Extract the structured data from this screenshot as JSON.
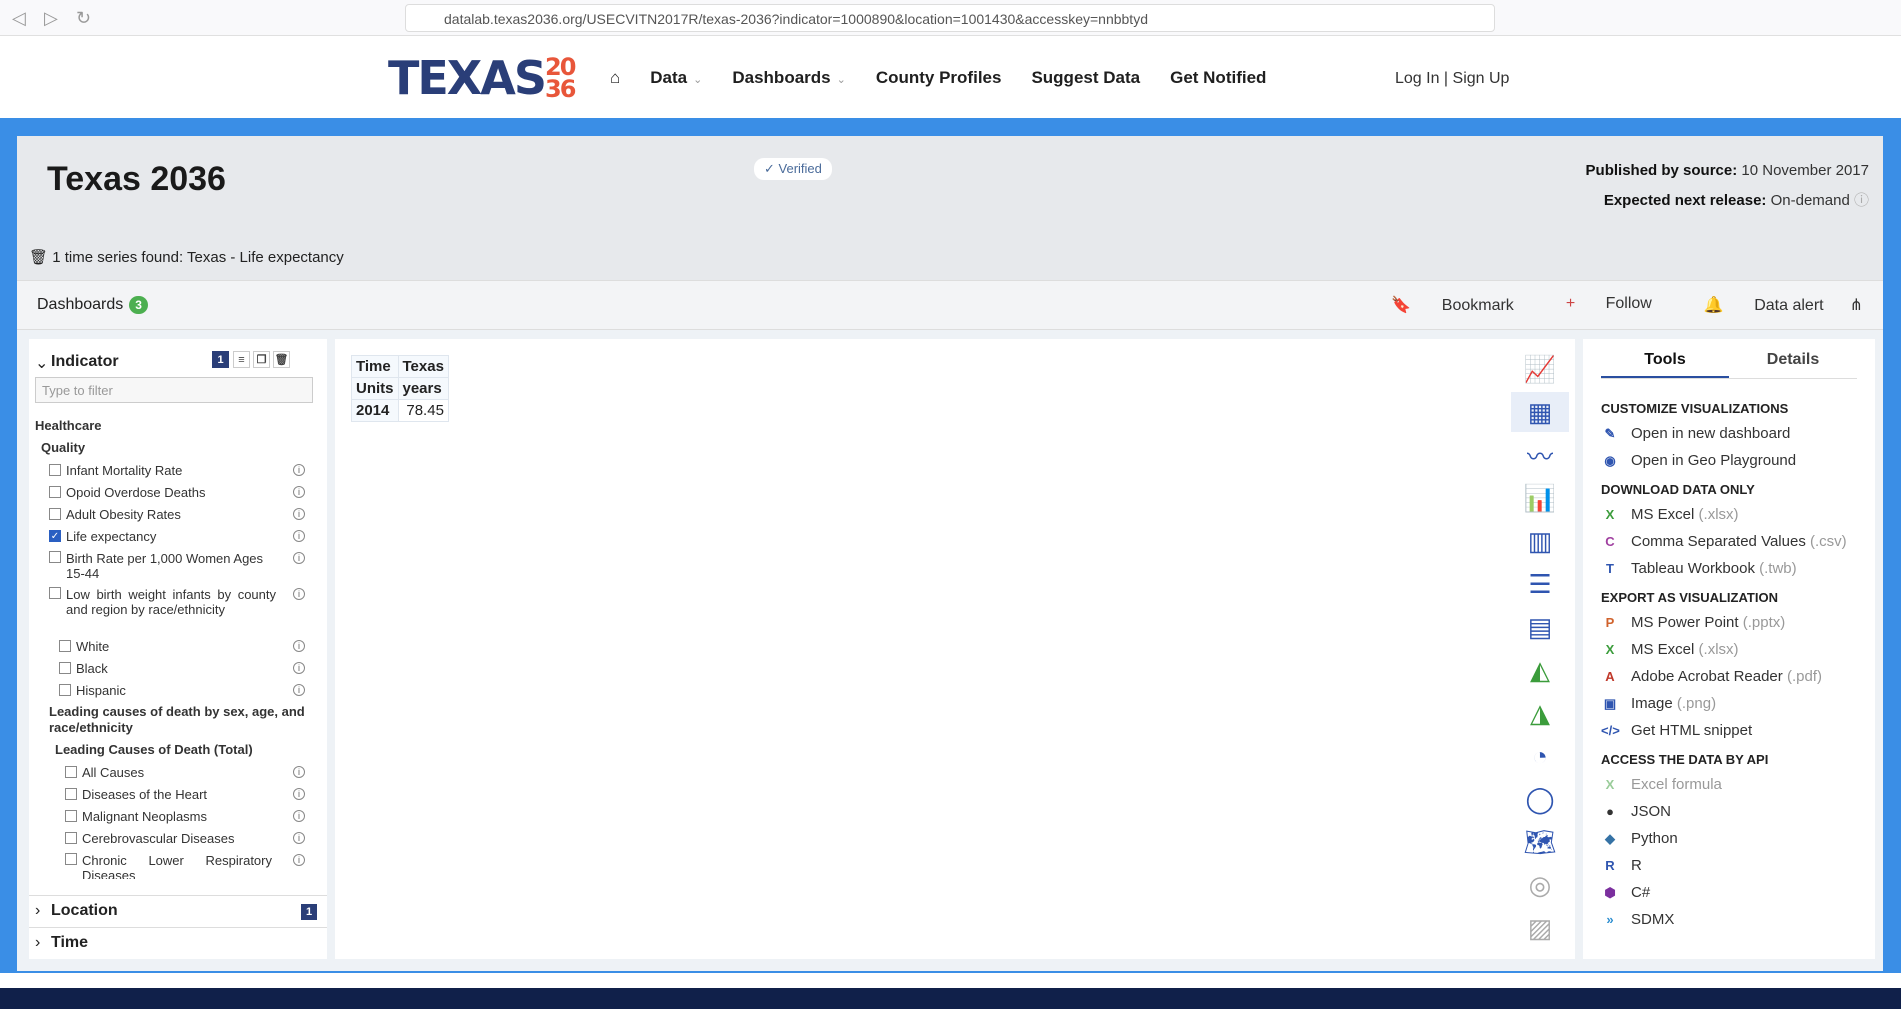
{
  "browser": {
    "url": "datalab.texas2036.org/USECVITN2017R/texas-2036?indicator=1000890&location=1001430&accesskey=nnbbtyd"
  },
  "site": {
    "logo_main": "TEXAS",
    "logo_num": "2036",
    "nav": [
      "Data",
      "Dashboards",
      "County Profiles",
      "Suggest Data",
      "Get Notified"
    ],
    "auth": "Log In | Sign Up"
  },
  "header": {
    "title": "Texas 2036",
    "verified": "✓ Verified",
    "published_label": "Published by source:",
    "published_value": "10 November 2017",
    "next_label": "Expected next release:",
    "next_value": "On-demand",
    "found": "1 time series found: Texas - Life expectancy"
  },
  "toolbar": {
    "dashboards": "Dashboards",
    "dashboards_count": "3",
    "bookmark": "Bookmark",
    "follow": "Follow",
    "alert": "Data alert"
  },
  "indicator": {
    "title": "Indicator",
    "count": "1",
    "filter_placeholder": "Type to filter",
    "healthcare": "Healthcare",
    "quality": "Quality",
    "items": [
      "Infant Mortality Rate",
      "Opoid Overdose Deaths",
      "Adult Obesity Rates",
      "Life expectancy",
      "Birth Rate per 1,000 Women Ages 15-44",
      "Low birth weight infants by county and region by race/ethnicity"
    ],
    "sub": [
      "White",
      "Black",
      "Hispanic"
    ],
    "group2": "Leading causes of death by sex, age, and race/ethnicity",
    "group3": "Leading Causes of Death (Total)",
    "causes": [
      "All Causes",
      "Diseases of the Heart",
      "Malignant Neoplasms",
      "Cerebrovascular Diseases",
      "Chronic Lower Respiratory Diseases"
    ],
    "location": "Location",
    "location_count": "1",
    "time": "Time"
  },
  "table": {
    "h1": "Time",
    "h2": "Texas",
    "u1": "Units",
    "u2": "years",
    "r1": "2014",
    "r2": "78.45"
  },
  "tabs": {
    "tools": "Tools",
    "details": "Details"
  },
  "tools": {
    "customize": "CUSTOMIZE VISUALIZATIONS",
    "new_dash": "Open in new dashboard",
    "geo": "Open in Geo Playground",
    "download": "DOWNLOAD DATA ONLY",
    "xlsx": "MS Excel",
    "xlsx_ext": "(.xlsx)",
    "csv": "Comma Separated Values",
    "csv_ext": "(.csv)",
    "twb": "Tableau Workbook",
    "twb_ext": "(.twb)",
    "export": "EXPORT AS VISUALIZATION",
    "pptx": "MS Power Point",
    "pptx_ext": "(.pptx)",
    "xlsx2": "MS Excel",
    "xlsx2_ext": "(.xlsx)",
    "pdf": "Adobe Acrobat Reader",
    "pdf_ext": "(.pdf)",
    "png": "Image",
    "png_ext": "(.png)",
    "html": "Get HTML snippet",
    "api": "ACCESS THE DATA BY API",
    "excel_formula": "Excel formula",
    "json": "JSON",
    "python": "Python",
    "r": "R",
    "csharp": "C#",
    "sdmx": "SDMX"
  }
}
